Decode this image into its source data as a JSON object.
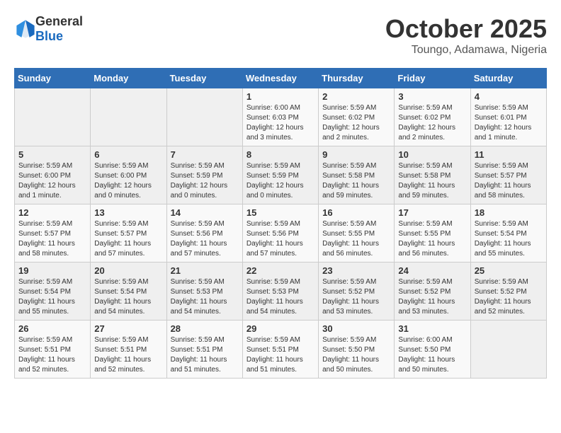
{
  "logo": {
    "general": "General",
    "blue": "Blue"
  },
  "header": {
    "month": "October 2025",
    "location": "Toungo, Adamawa, Nigeria"
  },
  "weekdays": [
    "Sunday",
    "Monday",
    "Tuesday",
    "Wednesday",
    "Thursday",
    "Friday",
    "Saturday"
  ],
  "weeks": [
    [
      {
        "day": "",
        "info": ""
      },
      {
        "day": "",
        "info": ""
      },
      {
        "day": "",
        "info": ""
      },
      {
        "day": "1",
        "info": "Sunrise: 6:00 AM\nSunset: 6:03 PM\nDaylight: 12 hours\nand 3 minutes."
      },
      {
        "day": "2",
        "info": "Sunrise: 5:59 AM\nSunset: 6:02 PM\nDaylight: 12 hours\nand 2 minutes."
      },
      {
        "day": "3",
        "info": "Sunrise: 5:59 AM\nSunset: 6:02 PM\nDaylight: 12 hours\nand 2 minutes."
      },
      {
        "day": "4",
        "info": "Sunrise: 5:59 AM\nSunset: 6:01 PM\nDaylight: 12 hours\nand 1 minute."
      }
    ],
    [
      {
        "day": "5",
        "info": "Sunrise: 5:59 AM\nSunset: 6:00 PM\nDaylight: 12 hours\nand 1 minute."
      },
      {
        "day": "6",
        "info": "Sunrise: 5:59 AM\nSunset: 6:00 PM\nDaylight: 12 hours\nand 0 minutes."
      },
      {
        "day": "7",
        "info": "Sunrise: 5:59 AM\nSunset: 5:59 PM\nDaylight: 12 hours\nand 0 minutes."
      },
      {
        "day": "8",
        "info": "Sunrise: 5:59 AM\nSunset: 5:59 PM\nDaylight: 12 hours\nand 0 minutes."
      },
      {
        "day": "9",
        "info": "Sunrise: 5:59 AM\nSunset: 5:58 PM\nDaylight: 11 hours\nand 59 minutes."
      },
      {
        "day": "10",
        "info": "Sunrise: 5:59 AM\nSunset: 5:58 PM\nDaylight: 11 hours\nand 59 minutes."
      },
      {
        "day": "11",
        "info": "Sunrise: 5:59 AM\nSunset: 5:57 PM\nDaylight: 11 hours\nand 58 minutes."
      }
    ],
    [
      {
        "day": "12",
        "info": "Sunrise: 5:59 AM\nSunset: 5:57 PM\nDaylight: 11 hours\nand 58 minutes."
      },
      {
        "day": "13",
        "info": "Sunrise: 5:59 AM\nSunset: 5:57 PM\nDaylight: 11 hours\nand 57 minutes."
      },
      {
        "day": "14",
        "info": "Sunrise: 5:59 AM\nSunset: 5:56 PM\nDaylight: 11 hours\nand 57 minutes."
      },
      {
        "day": "15",
        "info": "Sunrise: 5:59 AM\nSunset: 5:56 PM\nDaylight: 11 hours\nand 57 minutes."
      },
      {
        "day": "16",
        "info": "Sunrise: 5:59 AM\nSunset: 5:55 PM\nDaylight: 11 hours\nand 56 minutes."
      },
      {
        "day": "17",
        "info": "Sunrise: 5:59 AM\nSunset: 5:55 PM\nDaylight: 11 hours\nand 56 minutes."
      },
      {
        "day": "18",
        "info": "Sunrise: 5:59 AM\nSunset: 5:54 PM\nDaylight: 11 hours\nand 55 minutes."
      }
    ],
    [
      {
        "day": "19",
        "info": "Sunrise: 5:59 AM\nSunset: 5:54 PM\nDaylight: 11 hours\nand 55 minutes."
      },
      {
        "day": "20",
        "info": "Sunrise: 5:59 AM\nSunset: 5:54 PM\nDaylight: 11 hours\nand 54 minutes."
      },
      {
        "day": "21",
        "info": "Sunrise: 5:59 AM\nSunset: 5:53 PM\nDaylight: 11 hours\nand 54 minutes."
      },
      {
        "day": "22",
        "info": "Sunrise: 5:59 AM\nSunset: 5:53 PM\nDaylight: 11 hours\nand 54 minutes."
      },
      {
        "day": "23",
        "info": "Sunrise: 5:59 AM\nSunset: 5:52 PM\nDaylight: 11 hours\nand 53 minutes."
      },
      {
        "day": "24",
        "info": "Sunrise: 5:59 AM\nSunset: 5:52 PM\nDaylight: 11 hours\nand 53 minutes."
      },
      {
        "day": "25",
        "info": "Sunrise: 5:59 AM\nSunset: 5:52 PM\nDaylight: 11 hours\nand 52 minutes."
      }
    ],
    [
      {
        "day": "26",
        "info": "Sunrise: 5:59 AM\nSunset: 5:51 PM\nDaylight: 11 hours\nand 52 minutes."
      },
      {
        "day": "27",
        "info": "Sunrise: 5:59 AM\nSunset: 5:51 PM\nDaylight: 11 hours\nand 52 minutes."
      },
      {
        "day": "28",
        "info": "Sunrise: 5:59 AM\nSunset: 5:51 PM\nDaylight: 11 hours\nand 51 minutes."
      },
      {
        "day": "29",
        "info": "Sunrise: 5:59 AM\nSunset: 5:51 PM\nDaylight: 11 hours\nand 51 minutes."
      },
      {
        "day": "30",
        "info": "Sunrise: 5:59 AM\nSunset: 5:50 PM\nDaylight: 11 hours\nand 50 minutes."
      },
      {
        "day": "31",
        "info": "Sunrise: 6:00 AM\nSunset: 5:50 PM\nDaylight: 11 hours\nand 50 minutes."
      },
      {
        "day": "",
        "info": ""
      }
    ]
  ]
}
